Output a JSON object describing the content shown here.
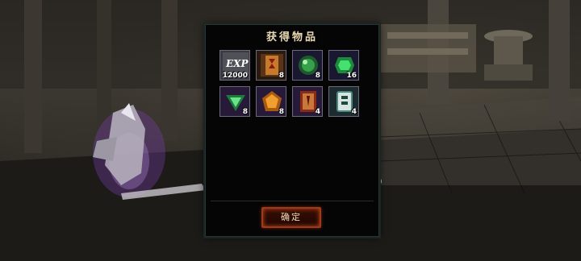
{
  "dialog": {
    "title": "获得物品",
    "confirm_label": "确定"
  },
  "items": [
    {
      "name": "exp-icon",
      "label": "EXP",
      "count": "12000",
      "bg": "#3a3a42"
    },
    {
      "name": "talisman-scroll-icon",
      "label": "",
      "count": "8",
      "bg": "#2a1a10"
    },
    {
      "name": "green-orb-icon",
      "label": "",
      "count": "8",
      "bg": "#1a1830"
    },
    {
      "name": "green-gem-icon",
      "label": "",
      "count": "16",
      "bg": "#1a1830"
    },
    {
      "name": "green-triangle-icon",
      "label": "",
      "count": "8",
      "bg": "#261a38"
    },
    {
      "name": "amber-crystal-icon",
      "label": "",
      "count": "8",
      "bg": "#261a38"
    },
    {
      "name": "red-book-icon",
      "label": "",
      "count": "4",
      "bg": "#261a38"
    },
    {
      "name": "mahjong-tile-icon",
      "label": "",
      "count": "4",
      "bg": "#1d2a30"
    }
  ]
}
